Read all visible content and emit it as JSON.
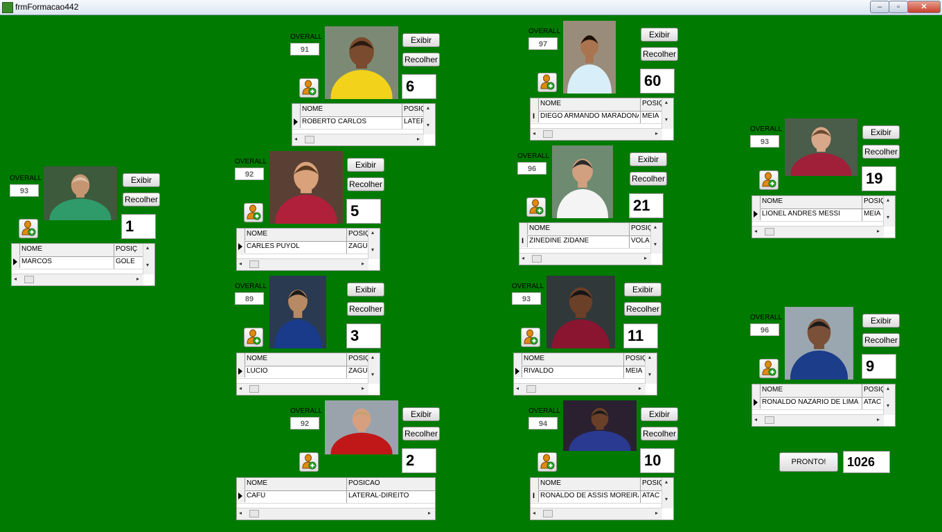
{
  "window": {
    "title": "frmFormacao442",
    "min": "–",
    "max": "▫",
    "close": "✕"
  },
  "labels": {
    "overall": "OVERALL",
    "show": "Exibir",
    "collapse": "Recolher",
    "col_name": "NOME",
    "col_pos_short": "POSIÇ",
    "col_pos_full": "POSICAO"
  },
  "players": [
    {
      "overall": "93",
      "number": "1",
      "name": "MARCOS",
      "position": "GOLE"
    },
    {
      "overall": "91",
      "number": "6",
      "name": "ROBERTO CARLOS",
      "position": "LATEF"
    },
    {
      "overall": "92",
      "number": "5",
      "name": "CARLES PUYOL",
      "position": "ZAGU"
    },
    {
      "overall": "89",
      "number": "3",
      "name": "LÚCIO",
      "position": "ZAGU"
    },
    {
      "overall": "92",
      "number": "2",
      "name": "CAFÚ",
      "position": "LATERAL-DIREITO"
    },
    {
      "overall": "97",
      "number": "60",
      "name": "DIEGO ARMANDO MARADONA",
      "position": "MEIA"
    },
    {
      "overall": "96",
      "number": "21",
      "name": "ZINÉDINE ZIDANE",
      "position": "VOLA"
    },
    {
      "overall": "93",
      "number": "11",
      "name": "RIVALDO",
      "position": "MEIA"
    },
    {
      "overall": "94",
      "number": "10",
      "name": "RONALDO DE ASSIS MOREIRA",
      "position": "ATAC"
    },
    {
      "overall": "93",
      "number": "19",
      "name": "LIONEL ANDRÉS MESSI",
      "position": "MEIA"
    },
    {
      "overall": "96",
      "number": "9",
      "name": "RONALDO NAZÁRIO DE LIMA",
      "position": "ATAC"
    }
  ],
  "footer": {
    "ready_label": "PRONTO!",
    "total": "1026"
  }
}
